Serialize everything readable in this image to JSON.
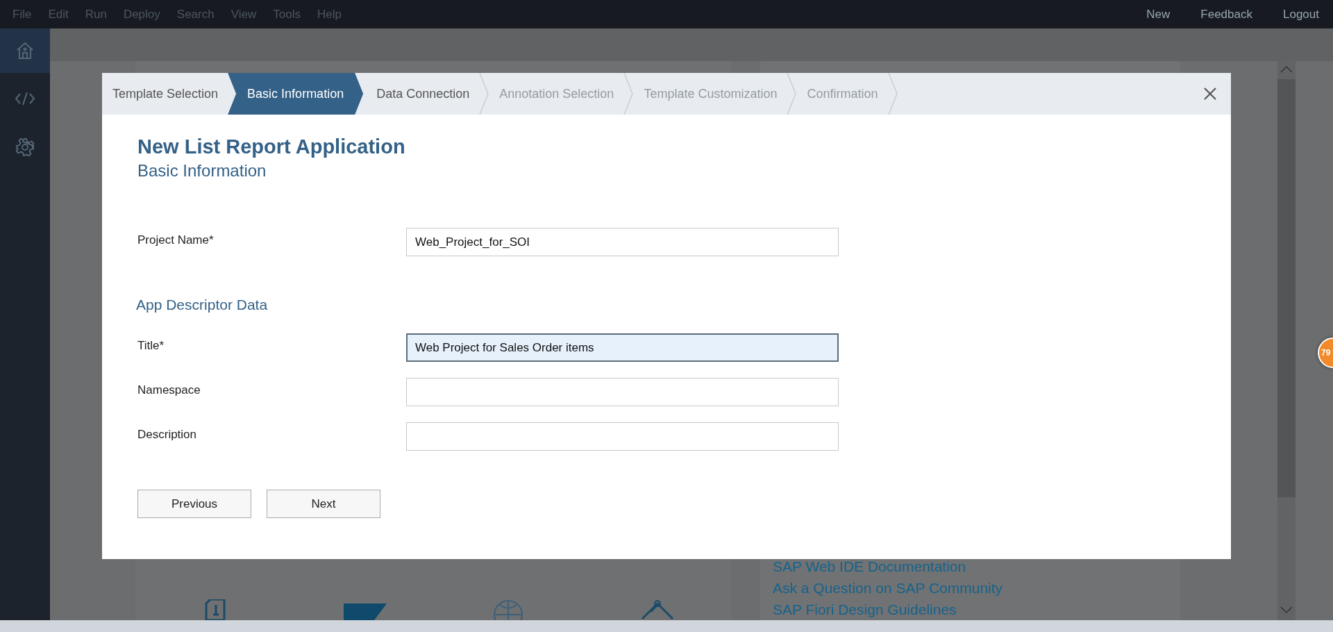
{
  "menu_bar": {
    "menus": [
      {
        "label": "File",
        "disabled": true
      },
      {
        "label": "Edit",
        "disabled": true
      },
      {
        "label": "Run",
        "disabled": true
      },
      {
        "label": "Deploy",
        "disabled": true
      },
      {
        "label": "Search",
        "disabled": true
      },
      {
        "label": "View",
        "disabled": true
      },
      {
        "label": "Tools",
        "disabled": true
      },
      {
        "label": "Help",
        "disabled": true
      }
    ],
    "actions": [
      "New",
      "Feedback",
      "Logout"
    ]
  },
  "sidebar": {
    "items": [
      {
        "kind": "home",
        "selected": true
      },
      {
        "kind": "code",
        "selected": false
      },
      {
        "kind": "settings",
        "selected": false
      }
    ]
  },
  "background": {
    "links": [
      "SAP Web IDE Documentation",
      "Ask a Question on SAP Community",
      "SAP Fiori Design Guidelines"
    ]
  },
  "dialog": {
    "steps": [
      {
        "label": "Template Selection",
        "selected": false,
        "disabled": false
      },
      {
        "label": "Basic Information",
        "selected": true,
        "disabled": false
      },
      {
        "label": "Data Connection",
        "selected": false,
        "disabled": false
      },
      {
        "label": "Annotation Selection",
        "selected": false,
        "disabled": true
      },
      {
        "label": "Template Customization",
        "selected": false,
        "disabled": true
      },
      {
        "label": "Confirmation",
        "selected": false,
        "disabled": true
      }
    ],
    "title": "New List Report Application",
    "subtitle": "Basic Information",
    "fields": [
      {
        "label": "Project Name*",
        "value": "Web_Project_for_SOI",
        "focused": false
      }
    ],
    "section": "App Descriptor Data",
    "descriptor_fields": [
      {
        "label": "Title*",
        "value": "Web Project for Sales Order items",
        "focused": true
      },
      {
        "label": "Namespace",
        "focused": false
      },
      {
        "label": "Description",
        "focused": false
      }
    ],
    "buttons": [
      "Previous",
      "Next"
    ]
  },
  "badge": {
    "count": "79"
  }
}
